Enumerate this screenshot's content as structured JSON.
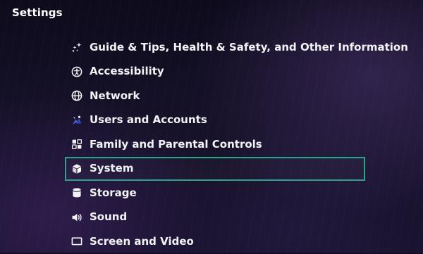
{
  "header": {
    "title": "Settings"
  },
  "menu": {
    "selected_index": 4,
    "items": [
      {
        "label": "Guide & Tips, Health & Safety, and Other Information",
        "icon": "sparkle-icon"
      },
      {
        "label": "Accessibility",
        "icon": "accessibility-icon"
      },
      {
        "label": "Network",
        "icon": "globe-icon"
      },
      {
        "label": "Users and Accounts",
        "icon": "user-icon"
      },
      {
        "label": "Family and Parental Controls",
        "icon": "family-icon"
      },
      {
        "label": "System",
        "icon": "cube-icon"
      },
      {
        "label": "Storage",
        "icon": "database-icon"
      },
      {
        "label": "Sound",
        "icon": "speaker-icon"
      },
      {
        "label": "Screen and Video",
        "icon": "screen-icon"
      }
    ]
  },
  "colors": {
    "background": "#140f24",
    "text": "#f2f2f5",
    "focus_border": "#2aa38a",
    "user_icon_accent": "#4b63d9"
  }
}
